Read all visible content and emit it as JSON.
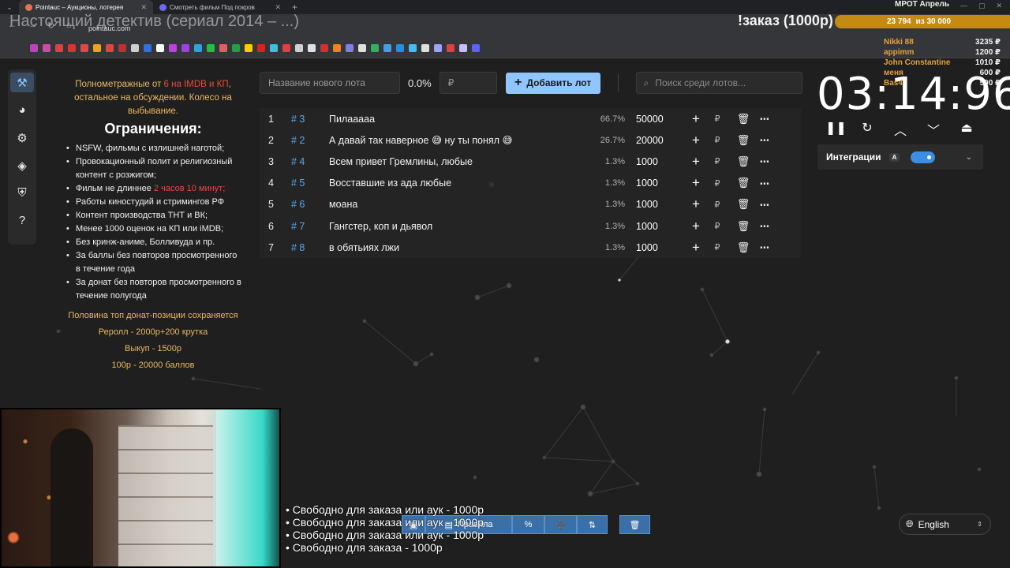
{
  "browser": {
    "tabs": [
      {
        "label": "Pointauc – Аукционы, лотерея",
        "active": true
      },
      {
        "label": "Смотреть фильм Под покров",
        "active": false
      }
    ],
    "url": "pointauc.com"
  },
  "stream_overlay": {
    "title": "Настоящий детектив (сериал 2014 – ...)",
    "order_banner": "!заказ (1000р)",
    "mrot": {
      "title": "МРОТ Апрель",
      "current": "23 794",
      "goal": "из 30 000"
    },
    "donors": [
      {
        "name": "Nikki 88",
        "amount": "3235 ₽"
      },
      {
        "name": "appimm",
        "amount": "1200 ₽"
      },
      {
        "name": "John Constantine",
        "amount": "1010 ₽"
      },
      {
        "name": "меня",
        "amount": "600 ₽"
      },
      {
        "name": "Bas4",
        "amount": "500 ₽"
      }
    ],
    "free_slots": [
      "• Свободно для заказа или аук - 1000р",
      "• Свободно для заказа или аук - 1000р",
      "• Свободно для заказа или аук - 1000р",
      "• Свободно для заказа - 1000р"
    ]
  },
  "sidebar": {
    "items": [
      {
        "icon": "gavel-icon",
        "glyph": "⚒",
        "active": true
      },
      {
        "icon": "wheel-icon",
        "glyph": "◕",
        "active": false
      },
      {
        "icon": "gear-icon",
        "glyph": "⚙",
        "active": false
      },
      {
        "icon": "layers-icon",
        "glyph": "◈",
        "active": false
      },
      {
        "icon": "shield-icon",
        "glyph": "⛨",
        "active": false
      },
      {
        "icon": "help-icon",
        "glyph": "?",
        "active": false
      }
    ]
  },
  "rules": {
    "intro_a": "Полнометражные от ",
    "intro_red": "6 на IMDB и КП",
    "intro_b": ", остальное на обсуждении. Колесо на выбывание.",
    "heading": "Ограничения:",
    "items": [
      "NSFW, фильмы с излишней наготой;",
      "Провокационный полит и религиозный контент с розжигом;",
      "Фильм не длиннее",
      "Работы киностудий и стримингов РФ",
      "Контент производства ТНТ и ВК;",
      "Менее 1000 оценок на КП или iMDB;",
      "Без кринж-аниме, Болливуда и пр.",
      "За баллы без повторов просмотренного в течение года",
      "За донат без повторов просмотренного в течение полугода"
    ],
    "length_red": " 2 часов 10 минут;",
    "footer": [
      "Половина топ донат-позиции сохраняется",
      "Реролл - 2000р+200 крутка",
      "Выкуп - 1500р",
      "100р - 20000 баллов"
    ]
  },
  "lot_form": {
    "name_placeholder": "Название нового лота",
    "percent": "0.0%",
    "amount_placeholder": "₽",
    "add_label": "Добавить лот",
    "search_placeholder": "Поиск среди лотов..."
  },
  "lots": [
    {
      "n": "1",
      "id": "# 3",
      "name": "Пилааааа",
      "pct": "66.7%",
      "amount": "50000"
    },
    {
      "n": "2",
      "id": "# 2",
      "name": "А давай так наверное 😅 ну ты понял 😅",
      "pct": "26.7%",
      "amount": "20000"
    },
    {
      "n": "3",
      "id": "# 4",
      "name": "Всем привет Гремлины, любые",
      "pct": "1.3%",
      "amount": "1000"
    },
    {
      "n": "4",
      "id": "# 5",
      "name": "Восставшие из ада  любые",
      "pct": "1.3%",
      "amount": "1000"
    },
    {
      "n": "5",
      "id": "# 6",
      "name": "моана",
      "pct": "1.3%",
      "amount": "1000"
    },
    {
      "n": "6",
      "id": "# 7",
      "name": "Гангстер, коп и дьявол",
      "pct": "1.3%",
      "amount": "1000"
    },
    {
      "n": "7",
      "id": "# 8",
      "name": "в обятьиях лжи",
      "pct": "1.3%",
      "amount": "1000"
    }
  ],
  "currency": "₽",
  "timer": {
    "display": "03:14:96"
  },
  "integrations": {
    "label": "Интеграции",
    "hotkey": "A",
    "enabled": true
  },
  "language": {
    "selected": "English"
  },
  "bottom_toolbar": {
    "rules_label": "Правила",
    "percent_glyph": "%"
  }
}
